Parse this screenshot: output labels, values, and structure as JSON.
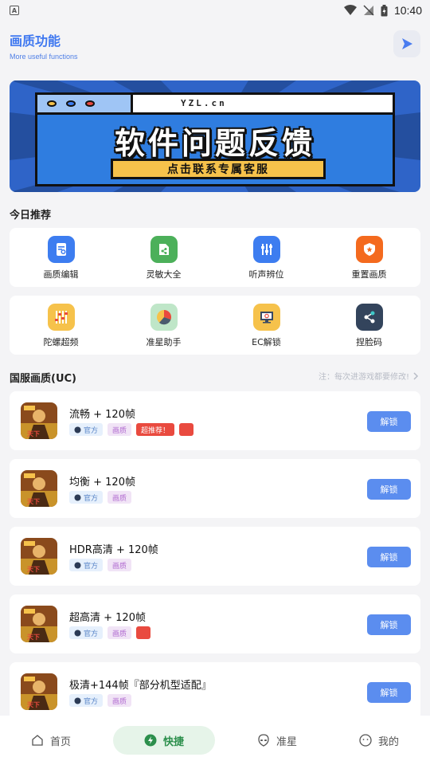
{
  "status_bar": {
    "time": "10:40"
  },
  "header": {
    "title": "画质功能",
    "subtitle": "More useful functions"
  },
  "banner": {
    "url": "YZL.cn",
    "headline": "软件问题反馈",
    "cta": "点击联系专属客服"
  },
  "today": {
    "title": "今日推荐",
    "row1": [
      {
        "label": "画质编辑",
        "icon": "edit-doc-icon",
        "color": "#3d7df0"
      },
      {
        "label": "灵敏大全",
        "icon": "share-folder-icon",
        "color": "#4cb05a"
      },
      {
        "label": "听声辨位",
        "icon": "equalizer-icon",
        "color": "#3d7df0"
      },
      {
        "label": "重置画质",
        "icon": "shield-star-icon",
        "color": "#f46a1e"
      }
    ],
    "row2": [
      {
        "label": "陀螺超频",
        "icon": "slider-controls-icon",
        "color": "#f6c24b"
      },
      {
        "label": "准星助手",
        "icon": "pie-chart-icon",
        "color": "#bfe6c8"
      },
      {
        "label": "EC解锁",
        "icon": "monitor-icon",
        "color": "#f6c24b"
      },
      {
        "label": "捏脸码",
        "icon": "share-nodes-icon",
        "color": "#33445c"
      }
    ]
  },
  "uc": {
    "title": "国服画质(UC)",
    "note": "注：每次进游戏都要修改!",
    "items": [
      {
        "title": "流畅 + 120帧",
        "tag_official": "官方",
        "tag_quality": "画质",
        "tag_hot": "超推荐！",
        "button": "解锁"
      },
      {
        "title": "均衡 + 120帧",
        "tag_official": "官方",
        "tag_quality": "画质",
        "button": "解锁"
      },
      {
        "title": "HDR高清 + 120帧",
        "tag_official": "官方",
        "tag_quality": "画质",
        "button": "解锁"
      },
      {
        "title": "超高清 + 120帧",
        "tag_official": "官方",
        "tag_quality": "画质",
        "button": "解锁"
      },
      {
        "title": "极清+144帧『部分机型适配』",
        "tag_official": "官方",
        "tag_quality": "画质",
        "button": "解锁"
      }
    ]
  },
  "tabbar": {
    "tabs": [
      {
        "label": "首页",
        "icon": "home-icon"
      },
      {
        "label": "快捷",
        "icon": "lightning-icon"
      },
      {
        "label": "准星",
        "icon": "alien-icon"
      },
      {
        "label": "我的",
        "icon": "smile-icon"
      }
    ],
    "active_color": "#2c8f4c"
  }
}
